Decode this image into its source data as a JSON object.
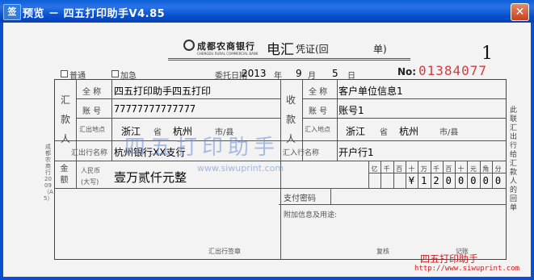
{
  "window": {
    "icon_label": "签",
    "title": "预览 － 四五打印助手V4.85",
    "close_glyph": "✕"
  },
  "slip": {
    "bank_name": "成都农商银行",
    "bank_name_en": "CHENGDU RURAL COMMERCIAL BANK",
    "form_title": "电汇",
    "form_subtitle": "凭证(回",
    "form_subtitle2": "单)",
    "copy_number": "1",
    "serial_label": "No:",
    "serial_number": "01384077",
    "checkbox_normal": "普通",
    "checkbox_urgent": "加急",
    "date_label": "委托日期",
    "year": "2013",
    "year_unit": "年",
    "month": "9",
    "month_unit": "月",
    "day": "5",
    "day_unit": "日",
    "remitter_vertical": "汇款人",
    "payee_vertical": "收款人",
    "full_name_label": "全 称",
    "account_label": "账 号",
    "remitter_place_label": "汇出地点",
    "payee_place_label": "汇入地点",
    "remitter_name": "四五打印助手四五打印",
    "remitter_account": "77777777777777",
    "remitter_province": "浙江",
    "remitter_province_unit": "省",
    "remitter_city": "杭州",
    "remitter_city_unit": "市/县",
    "payee_name": "客户单位信息1",
    "payee_account": "账号1",
    "payee_province": "浙江",
    "payee_province_unit": "省",
    "payee_city": "杭州",
    "payee_city_unit": "市/县",
    "remitter_bank_label": "汇出行名称",
    "remitter_bank": "杭州银行XX支行",
    "payee_bank_label": "汇入行名称",
    "payee_bank": "开户行1",
    "amount_label_top": "人民币",
    "amount_label_bottom": "(大写)",
    "amount_side": "金额",
    "amount_words": "壹万贰仟元整",
    "amount_headers": [
      "亿",
      "千",
      "百",
      "十",
      "万",
      "千",
      "百",
      "十",
      "元",
      "角",
      "分"
    ],
    "amount_digits": [
      "",
      "",
      "",
      "¥",
      "1",
      "2",
      "0",
      "0",
      "0",
      "0",
      "0"
    ],
    "password_label": "支付密码",
    "extra_label": "附加信息及用途:",
    "seal_label": "汇出行签章",
    "review_label": "复核",
    "bookkeeping_label": "记账",
    "side_note": "此联汇出行给汇款人的回单",
    "left_side_note": "成都农商行2009（A5）"
  },
  "watermark": {
    "text1": "四五打印助手",
    "url1": "www.siwuprint.com",
    "brand": "四五打印助手",
    "url2": "http://www.siwuprint.com"
  },
  "colors": {
    "titlebar": "#0a5fd7",
    "serial": "#d33c3c",
    "watermark": "#6b8fd6",
    "brand": "#d02020"
  }
}
